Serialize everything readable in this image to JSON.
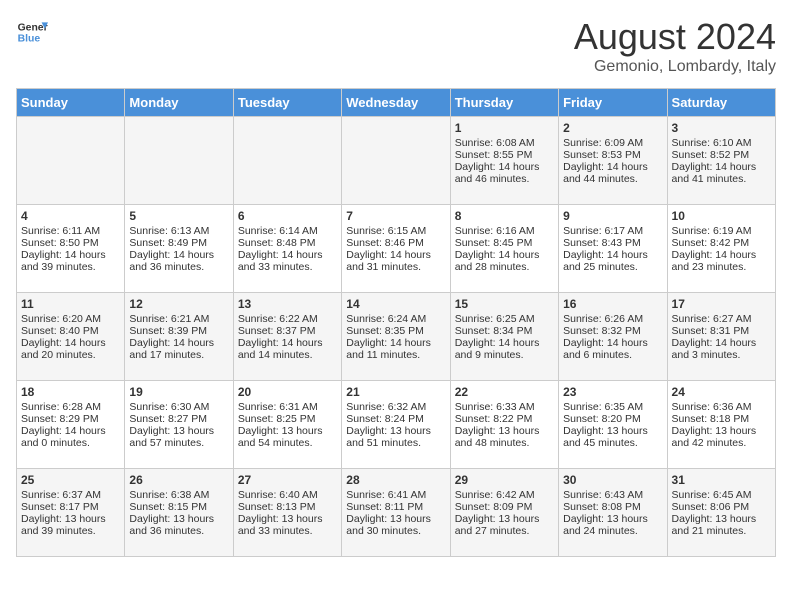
{
  "header": {
    "logo_general": "General",
    "logo_blue": "Blue",
    "month": "August 2024",
    "location": "Gemonio, Lombardy, Italy"
  },
  "days_of_week": [
    "Sunday",
    "Monday",
    "Tuesday",
    "Wednesday",
    "Thursday",
    "Friday",
    "Saturday"
  ],
  "weeks": [
    [
      {
        "day": "",
        "content": ""
      },
      {
        "day": "",
        "content": ""
      },
      {
        "day": "",
        "content": ""
      },
      {
        "day": "",
        "content": ""
      },
      {
        "day": "1",
        "content": "Sunrise: 6:08 AM\nSunset: 8:55 PM\nDaylight: 14 hours and 46 minutes."
      },
      {
        "day": "2",
        "content": "Sunrise: 6:09 AM\nSunset: 8:53 PM\nDaylight: 14 hours and 44 minutes."
      },
      {
        "day": "3",
        "content": "Sunrise: 6:10 AM\nSunset: 8:52 PM\nDaylight: 14 hours and 41 minutes."
      }
    ],
    [
      {
        "day": "4",
        "content": "Sunrise: 6:11 AM\nSunset: 8:50 PM\nDaylight: 14 hours and 39 minutes."
      },
      {
        "day": "5",
        "content": "Sunrise: 6:13 AM\nSunset: 8:49 PM\nDaylight: 14 hours and 36 minutes."
      },
      {
        "day": "6",
        "content": "Sunrise: 6:14 AM\nSunset: 8:48 PM\nDaylight: 14 hours and 33 minutes."
      },
      {
        "day": "7",
        "content": "Sunrise: 6:15 AM\nSunset: 8:46 PM\nDaylight: 14 hours and 31 minutes."
      },
      {
        "day": "8",
        "content": "Sunrise: 6:16 AM\nSunset: 8:45 PM\nDaylight: 14 hours and 28 minutes."
      },
      {
        "day": "9",
        "content": "Sunrise: 6:17 AM\nSunset: 8:43 PM\nDaylight: 14 hours and 25 minutes."
      },
      {
        "day": "10",
        "content": "Sunrise: 6:19 AM\nSunset: 8:42 PM\nDaylight: 14 hours and 23 minutes."
      }
    ],
    [
      {
        "day": "11",
        "content": "Sunrise: 6:20 AM\nSunset: 8:40 PM\nDaylight: 14 hours and 20 minutes."
      },
      {
        "day": "12",
        "content": "Sunrise: 6:21 AM\nSunset: 8:39 PM\nDaylight: 14 hours and 17 minutes."
      },
      {
        "day": "13",
        "content": "Sunrise: 6:22 AM\nSunset: 8:37 PM\nDaylight: 14 hours and 14 minutes."
      },
      {
        "day": "14",
        "content": "Sunrise: 6:24 AM\nSunset: 8:35 PM\nDaylight: 14 hours and 11 minutes."
      },
      {
        "day": "15",
        "content": "Sunrise: 6:25 AM\nSunset: 8:34 PM\nDaylight: 14 hours and 9 minutes."
      },
      {
        "day": "16",
        "content": "Sunrise: 6:26 AM\nSunset: 8:32 PM\nDaylight: 14 hours and 6 minutes."
      },
      {
        "day": "17",
        "content": "Sunrise: 6:27 AM\nSunset: 8:31 PM\nDaylight: 14 hours and 3 minutes."
      }
    ],
    [
      {
        "day": "18",
        "content": "Sunrise: 6:28 AM\nSunset: 8:29 PM\nDaylight: 14 hours and 0 minutes."
      },
      {
        "day": "19",
        "content": "Sunrise: 6:30 AM\nSunset: 8:27 PM\nDaylight: 13 hours and 57 minutes."
      },
      {
        "day": "20",
        "content": "Sunrise: 6:31 AM\nSunset: 8:25 PM\nDaylight: 13 hours and 54 minutes."
      },
      {
        "day": "21",
        "content": "Sunrise: 6:32 AM\nSunset: 8:24 PM\nDaylight: 13 hours and 51 minutes."
      },
      {
        "day": "22",
        "content": "Sunrise: 6:33 AM\nSunset: 8:22 PM\nDaylight: 13 hours and 48 minutes."
      },
      {
        "day": "23",
        "content": "Sunrise: 6:35 AM\nSunset: 8:20 PM\nDaylight: 13 hours and 45 minutes."
      },
      {
        "day": "24",
        "content": "Sunrise: 6:36 AM\nSunset: 8:18 PM\nDaylight: 13 hours and 42 minutes."
      }
    ],
    [
      {
        "day": "25",
        "content": "Sunrise: 6:37 AM\nSunset: 8:17 PM\nDaylight: 13 hours and 39 minutes."
      },
      {
        "day": "26",
        "content": "Sunrise: 6:38 AM\nSunset: 8:15 PM\nDaylight: 13 hours and 36 minutes."
      },
      {
        "day": "27",
        "content": "Sunrise: 6:40 AM\nSunset: 8:13 PM\nDaylight: 13 hours and 33 minutes."
      },
      {
        "day": "28",
        "content": "Sunrise: 6:41 AM\nSunset: 8:11 PM\nDaylight: 13 hours and 30 minutes."
      },
      {
        "day": "29",
        "content": "Sunrise: 6:42 AM\nSunset: 8:09 PM\nDaylight: 13 hours and 27 minutes."
      },
      {
        "day": "30",
        "content": "Sunrise: 6:43 AM\nSunset: 8:08 PM\nDaylight: 13 hours and 24 minutes."
      },
      {
        "day": "31",
        "content": "Sunrise: 6:45 AM\nSunset: 8:06 PM\nDaylight: 13 hours and 21 minutes."
      }
    ]
  ]
}
